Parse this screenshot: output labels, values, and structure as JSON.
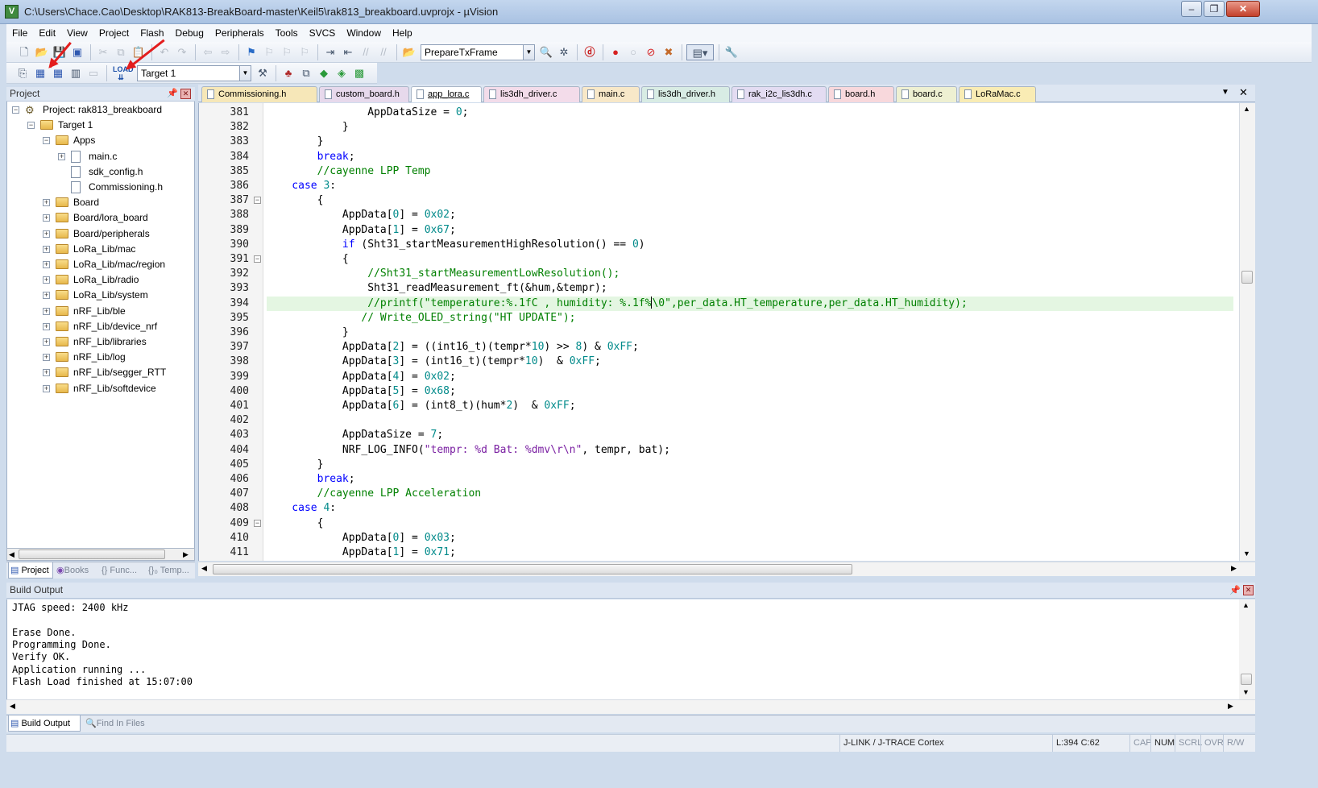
{
  "window": {
    "title": "C:\\Users\\Chace.Cao\\Desktop\\RAK813-BreakBoard-master\\Keil5\\rak813_breakboard.uvprojx - µVision"
  },
  "menu": [
    "File",
    "Edit",
    "View",
    "Project",
    "Flash",
    "Debug",
    "Peripherals",
    "Tools",
    "SVCS",
    "Window",
    "Help"
  ],
  "toolbar": {
    "function_combo": "PrepareTxFrame",
    "target_combo": "Target 1"
  },
  "project_panel": {
    "title": "Project",
    "tree": [
      {
        "label": "Project: rak813_breakboard",
        "type": "project",
        "level": 0,
        "expander": "−"
      },
      {
        "label": "Target 1",
        "type": "folder",
        "level": 1,
        "expander": "−"
      },
      {
        "label": "Apps",
        "type": "folder",
        "level": 2,
        "expander": "−"
      },
      {
        "label": "main.c",
        "type": "file",
        "level": 3,
        "expander": "+"
      },
      {
        "label": "sdk_config.h",
        "type": "file",
        "level": 3,
        "expander": ""
      },
      {
        "label": "Commissioning.h",
        "type": "file",
        "level": 3,
        "expander": ""
      },
      {
        "label": "Board",
        "type": "folder",
        "level": 2,
        "expander": "+"
      },
      {
        "label": "Board/lora_board",
        "type": "folder",
        "level": 2,
        "expander": "+"
      },
      {
        "label": "Board/peripherals",
        "type": "folder",
        "level": 2,
        "expander": "+"
      },
      {
        "label": "LoRa_Lib/mac",
        "type": "folder",
        "level": 2,
        "expander": "+"
      },
      {
        "label": "LoRa_Lib/mac/region",
        "type": "folder",
        "level": 2,
        "expander": "+"
      },
      {
        "label": "LoRa_Lib/radio",
        "type": "folder",
        "level": 2,
        "expander": "+"
      },
      {
        "label": "LoRa_Lib/system",
        "type": "folder",
        "level": 2,
        "expander": "+"
      },
      {
        "label": "nRF_Lib/ble",
        "type": "folder",
        "level": 2,
        "expander": "+"
      },
      {
        "label": "nRF_Lib/device_nrf",
        "type": "folder",
        "level": 2,
        "expander": "+"
      },
      {
        "label": "nRF_Lib/libraries",
        "type": "folder",
        "level": 2,
        "expander": "+"
      },
      {
        "label": "nRF_Lib/log",
        "type": "folder",
        "level": 2,
        "expander": "+"
      },
      {
        "label": "nRF_Lib/segger_RTT",
        "type": "folder",
        "level": 2,
        "expander": "+"
      },
      {
        "label": "nRF_Lib/softdevice",
        "type": "folder",
        "level": 2,
        "expander": "+"
      }
    ],
    "tabs": [
      "Project",
      "Books",
      "{} Func...",
      "{}₀ Temp..."
    ]
  },
  "editor_tabs": [
    {
      "label": "Commissioning.h",
      "color": "#f6e7b8",
      "active": false
    },
    {
      "label": "custom_board.h",
      "color": "#e7d9ec",
      "active": false
    },
    {
      "label": "app_lora.c",
      "color": "#ffffff",
      "active": true
    },
    {
      "label": "lis3dh_driver.c",
      "color": "#f3dcea",
      "active": false
    },
    {
      "label": "main.c",
      "color": "#f8e8c8",
      "active": false
    },
    {
      "label": "lis3dh_driver.h",
      "color": "#d8ece4",
      "active": false
    },
    {
      "label": "rak_i2c_lis3dh.c",
      "color": "#e3dcf2",
      "active": false
    },
    {
      "label": "board.h",
      "color": "#f8d8dc",
      "active": false
    },
    {
      "label": "board.c",
      "color": "#eef0d2",
      "active": false
    },
    {
      "label": "LoRaMac.c",
      "color": "#f9ecb4",
      "active": false
    }
  ],
  "code": {
    "lines": [
      {
        "n": "381",
        "fold": false,
        "segs": [
          [
            "",
            "                AppDataSize = "
          ],
          [
            "num",
            "0"
          ],
          [
            "",
            ";"
          ]
        ]
      },
      {
        "n": "382",
        "fold": false,
        "segs": [
          [
            "",
            "            }"
          ]
        ]
      },
      {
        "n": "383",
        "fold": false,
        "segs": [
          [
            "",
            "        }"
          ]
        ]
      },
      {
        "n": "384",
        "fold": false,
        "segs": [
          [
            "kw",
            "        break"
          ],
          [
            "",
            ";"
          ]
        ]
      },
      {
        "n": "385",
        "fold": false,
        "segs": [
          [
            "cm",
            "        //cayenne LPP Temp"
          ]
        ]
      },
      {
        "n": "386",
        "fold": false,
        "segs": [
          [
            "kw",
            "    case "
          ],
          [
            "num",
            "3"
          ],
          [
            "",
            ":"
          ]
        ]
      },
      {
        "n": "387",
        "fold": true,
        "segs": [
          [
            "",
            "        {"
          ]
        ]
      },
      {
        "n": "388",
        "fold": false,
        "segs": [
          [
            "",
            "            AppData["
          ],
          [
            "num",
            "0"
          ],
          [
            "",
            "] = "
          ],
          [
            "num",
            "0x02"
          ],
          [
            "",
            ";"
          ]
        ]
      },
      {
        "n": "389",
        "fold": false,
        "segs": [
          [
            "",
            "            AppData["
          ],
          [
            "num",
            "1"
          ],
          [
            "",
            "] = "
          ],
          [
            "num",
            "0x67"
          ],
          [
            "",
            ";"
          ]
        ]
      },
      {
        "n": "390",
        "fold": false,
        "segs": [
          [
            "kw",
            "            if"
          ],
          [
            "",
            " (Sht31_startMeasurementHighResolution() == "
          ],
          [
            "num",
            "0"
          ],
          [
            "",
            ")"
          ]
        ]
      },
      {
        "n": "391",
        "fold": true,
        "segs": [
          [
            "",
            "            {"
          ]
        ]
      },
      {
        "n": "392",
        "fold": false,
        "segs": [
          [
            "cm",
            "                //Sht31_startMeasurementLowResolution();"
          ]
        ]
      },
      {
        "n": "393",
        "fold": false,
        "segs": [
          [
            "",
            "                Sht31_readMeasurement_ft(&hum,&tempr);"
          ]
        ]
      },
      {
        "n": "394",
        "fold": false,
        "hl": true,
        "segs": [
          [
            "cm",
            "                //printf(\"temperature:%.1fC , humidity: %.1f%"
          ],
          [
            "caret",
            ""
          ],
          [
            "cm",
            "\\0\",per_data.HT_temperature,per_data.HT_humidity);"
          ]
        ]
      },
      {
        "n": "395",
        "fold": false,
        "segs": [
          [
            "cm",
            "               // Write_OLED_string(\"HT UPDATE\");"
          ]
        ]
      },
      {
        "n": "396",
        "fold": false,
        "segs": [
          [
            "",
            "            }"
          ]
        ]
      },
      {
        "n": "397",
        "fold": false,
        "segs": [
          [
            "",
            "            AppData["
          ],
          [
            "num",
            "2"
          ],
          [
            "",
            "] = ((int16_t)(tempr*"
          ],
          [
            "num",
            "10"
          ],
          [
            "",
            ") >> "
          ],
          [
            "num",
            "8"
          ],
          [
            "",
            ") & "
          ],
          [
            "num",
            "0xFF"
          ],
          [
            "",
            ";"
          ]
        ]
      },
      {
        "n": "398",
        "fold": false,
        "segs": [
          [
            "",
            "            AppData["
          ],
          [
            "num",
            "3"
          ],
          [
            "",
            "] = (int16_t)(tempr*"
          ],
          [
            "num",
            "10"
          ],
          [
            "",
            ")  & "
          ],
          [
            "num",
            "0xFF"
          ],
          [
            "",
            ";"
          ]
        ]
      },
      {
        "n": "399",
        "fold": false,
        "segs": [
          [
            "",
            "            AppData["
          ],
          [
            "num",
            "4"
          ],
          [
            "",
            "] = "
          ],
          [
            "num",
            "0x02"
          ],
          [
            "",
            ";"
          ]
        ]
      },
      {
        "n": "400",
        "fold": false,
        "segs": [
          [
            "",
            "            AppData["
          ],
          [
            "num",
            "5"
          ],
          [
            "",
            "] = "
          ],
          [
            "num",
            "0x68"
          ],
          [
            "",
            ";"
          ]
        ]
      },
      {
        "n": "401",
        "fold": false,
        "segs": [
          [
            "",
            "            AppData["
          ],
          [
            "num",
            "6"
          ],
          [
            "",
            "] = (int8_t)(hum*"
          ],
          [
            "num",
            "2"
          ],
          [
            "",
            ")  & "
          ],
          [
            "num",
            "0xFF"
          ],
          [
            "",
            ";"
          ]
        ]
      },
      {
        "n": "402",
        "fold": false,
        "segs": [
          [
            "",
            ""
          ]
        ]
      },
      {
        "n": "403",
        "fold": false,
        "segs": [
          [
            "",
            "            AppDataSize = "
          ],
          [
            "num",
            "7"
          ],
          [
            "",
            ";"
          ]
        ]
      },
      {
        "n": "404",
        "fold": false,
        "segs": [
          [
            "",
            "            NRF_LOG_INFO("
          ],
          [
            "st2",
            "\"tempr: %d Bat: %dmv\\r\\n\""
          ],
          [
            "",
            ", tempr, bat);"
          ]
        ]
      },
      {
        "n": "405",
        "fold": false,
        "segs": [
          [
            "",
            "        }"
          ]
        ]
      },
      {
        "n": "406",
        "fold": false,
        "segs": [
          [
            "kw",
            "        break"
          ],
          [
            "",
            ";"
          ]
        ]
      },
      {
        "n": "407",
        "fold": false,
        "segs": [
          [
            "cm",
            "        //cayenne LPP Acceleration"
          ]
        ]
      },
      {
        "n": "408",
        "fold": false,
        "segs": [
          [
            "kw",
            "    case "
          ],
          [
            "num",
            "4"
          ],
          [
            "",
            ":"
          ]
        ]
      },
      {
        "n": "409",
        "fold": true,
        "segs": [
          [
            "",
            "        {"
          ]
        ]
      },
      {
        "n": "410",
        "fold": false,
        "segs": [
          [
            "",
            "            AppData["
          ],
          [
            "num",
            "0"
          ],
          [
            "",
            "] = "
          ],
          [
            "num",
            "0x03"
          ],
          [
            "",
            ";"
          ]
        ]
      },
      {
        "n": "411",
        "fold": false,
        "segs": [
          [
            "",
            "            AppData["
          ],
          [
            "num",
            "1"
          ],
          [
            "",
            "] = "
          ],
          [
            "num",
            "0x71"
          ],
          [
            "",
            ";"
          ]
        ]
      }
    ]
  },
  "build_output": {
    "title": "Build Output",
    "lines": [
      "JTAG speed: 2400 kHz",
      "",
      "Erase Done.",
      "Programming Done.",
      "Verify OK.",
      "Application running ...",
      "Flash Load finished at 15:07:00"
    ],
    "tabs": [
      "Build Output",
      "Find In Files"
    ]
  },
  "status": {
    "debugger": "J-LINK / J-TRACE Cortex",
    "position": "L:394 C:62",
    "caps": "CAP",
    "num": "NUM",
    "scrl": "SCRL",
    "ovr": "OVR",
    "rw": "R/W"
  },
  "colors": {
    "annotation_arrow": "#e31d1d",
    "highlight_line": "#e4f6e2"
  }
}
